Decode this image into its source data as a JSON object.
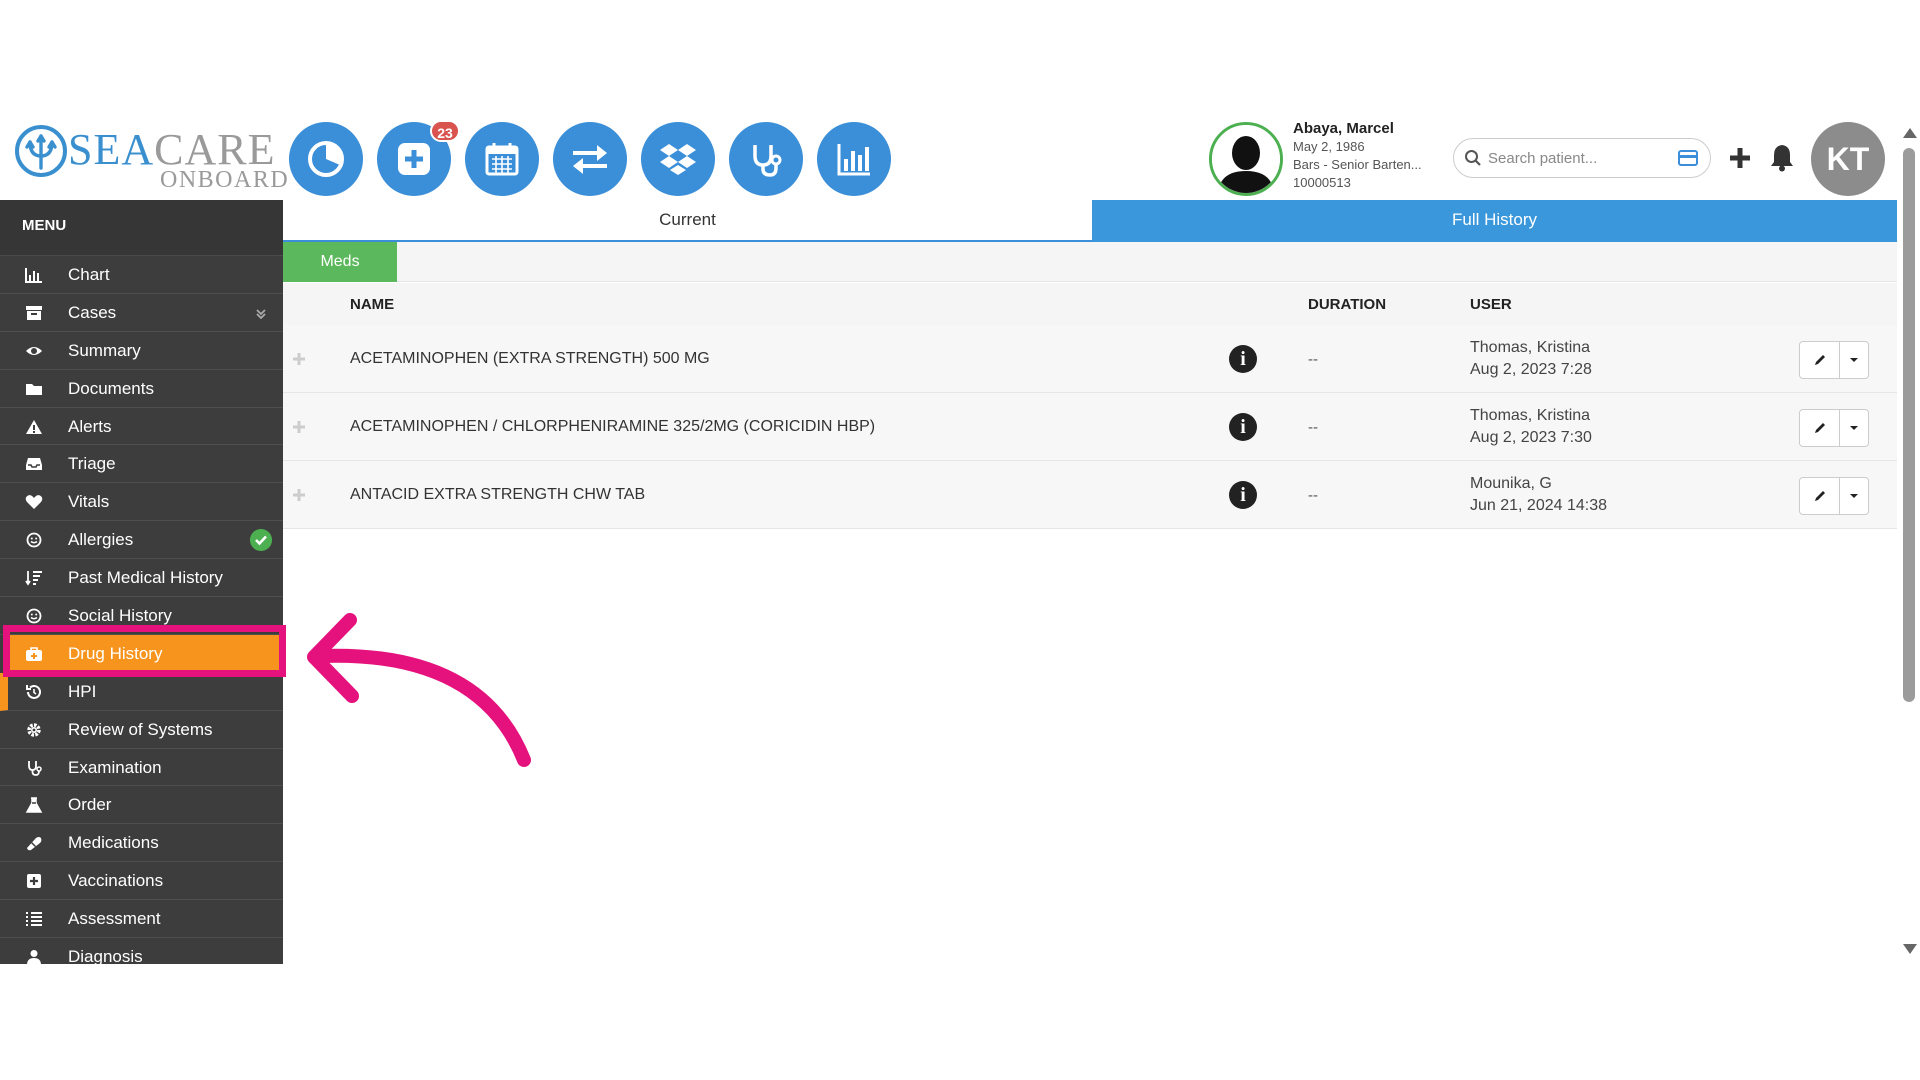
{
  "brand": {
    "word_sea": "SEA",
    "word_care": "CARE",
    "word_onboard": "ONBOARD"
  },
  "topnav": {
    "buttons": [
      {
        "icon": "pie-chart-icon"
      },
      {
        "icon": "medical-plus-icon",
        "badge": "23"
      },
      {
        "icon": "calendar-icon"
      },
      {
        "icon": "exchange-icon"
      },
      {
        "icon": "dropbox-icon"
      },
      {
        "icon": "stethoscope-icon"
      },
      {
        "icon": "bar-chart-icon"
      }
    ]
  },
  "patient": {
    "name": "Abaya, Marcel",
    "dob": "May 2, 1986",
    "role": "Bars - Senior Barten...",
    "id": "10000513"
  },
  "search": {
    "placeholder": "Search patient..."
  },
  "user": {
    "initials": "KT"
  },
  "sidebar": {
    "title": "MENU",
    "items": [
      {
        "label": "Chart",
        "icon": "bar-chart-icon"
      },
      {
        "label": "Cases",
        "icon": "archive-icon"
      },
      {
        "label": "Summary",
        "icon": "eye-icon"
      },
      {
        "label": "Documents",
        "icon": "folder-icon"
      },
      {
        "label": "Alerts",
        "icon": "warning-icon"
      },
      {
        "label": "Triage",
        "icon": "inbox-icon"
      },
      {
        "label": "Vitals",
        "icon": "heart-icon"
      },
      {
        "label": "Allergies",
        "icon": "smiley-icon"
      },
      {
        "label": "Past Medical History",
        "icon": "sort-icon"
      },
      {
        "label": "Social History",
        "icon": "smiley-icon"
      },
      {
        "label": "Drug History",
        "icon": "medkit-icon"
      },
      {
        "label": "HPI",
        "icon": "history-icon"
      },
      {
        "label": "Review of Systems",
        "icon": "cog-icon"
      },
      {
        "label": "Examination",
        "icon": "stethoscope-icon"
      },
      {
        "label": "Order",
        "icon": "flask-icon"
      },
      {
        "label": "Medications",
        "icon": "pill-icon"
      },
      {
        "label": "Vaccinations",
        "icon": "plus-square-icon"
      },
      {
        "label": "Assessment",
        "icon": "list-icon"
      },
      {
        "label": "Diagnosis",
        "icon": "user-md-icon"
      }
    ]
  },
  "tabs": {
    "current": "Current",
    "full_history": "Full History"
  },
  "subtabs": {
    "meds": "Meds"
  },
  "table": {
    "headers": {
      "name": "NAME",
      "duration": "DURATION",
      "user": "USER"
    },
    "rows": [
      {
        "name": "ACETAMINOPHEN (EXTRA STRENGTH) 500 MG",
        "duration": "--",
        "user": "Thomas, Kristina",
        "date": "Aug 2, 2023 7:28"
      },
      {
        "name": "ACETAMINOPHEN / CHLORPHENIRAMINE 325/2MG (CORICIDIN HBP)",
        "duration": "--",
        "user": "Thomas, Kristina",
        "date": "Aug 2, 2023 7:30"
      },
      {
        "name": "ANTACID EXTRA STRENGTH CHW TAB",
        "duration": "--",
        "user": "Mounika, G",
        "date": "Jun 21, 2024 14:38"
      }
    ]
  },
  "colors": {
    "accent": "#3a8fd8",
    "active": "#f7941d",
    "highlight": "#e5127d",
    "meds": "#5cb85c"
  }
}
